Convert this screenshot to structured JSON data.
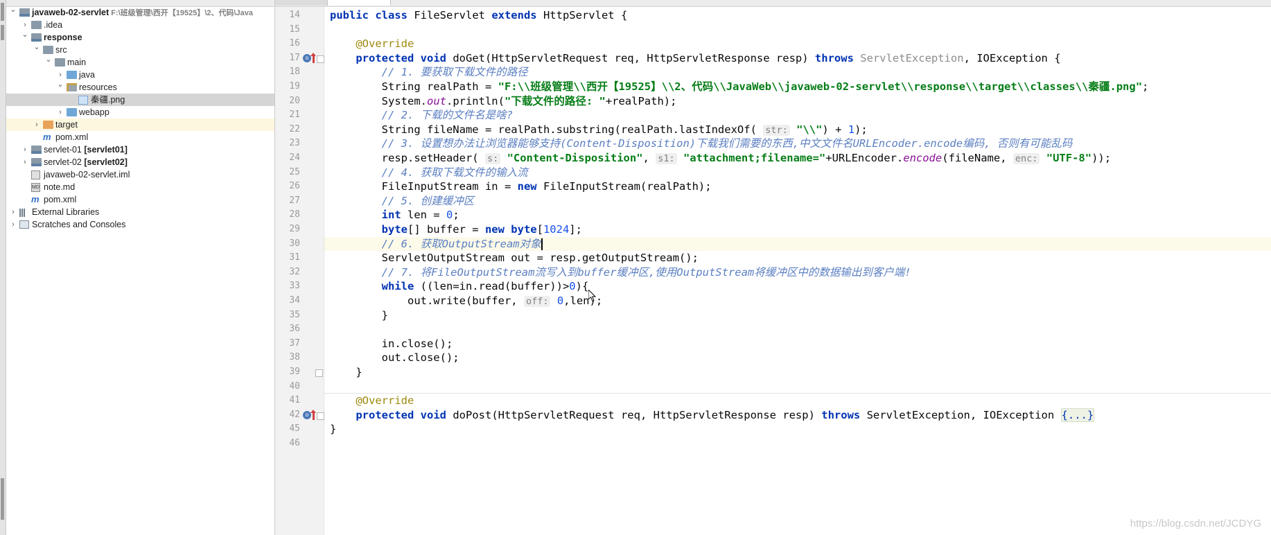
{
  "project_tree": [
    {
      "label": "javaweb-02-servlet",
      "suffix": "F:\\班级管理\\西开【19525】\\2、代码\\Java",
      "bold": true,
      "level": 0,
      "arrow": "down",
      "icon": "module-folder-icon"
    },
    {
      "label": ".idea",
      "level": 1,
      "arrow": "right",
      "icon": "folder-icon"
    },
    {
      "label": "response",
      "bold": true,
      "level": 1,
      "arrow": "down",
      "icon": "module-folder-icon"
    },
    {
      "label": "src",
      "level": 2,
      "arrow": "down",
      "icon": "folder-icon"
    },
    {
      "label": "main",
      "level": 3,
      "arrow": "down",
      "icon": "folder-icon"
    },
    {
      "label": "java",
      "level": 4,
      "arrow": "right",
      "icon": "source-folder-icon"
    },
    {
      "label": "resources",
      "level": 4,
      "arrow": "down",
      "icon": "resources-folder-icon"
    },
    {
      "label": "秦疆.png",
      "level": 5,
      "arrow": "",
      "icon": "image-file-icon",
      "selected": true
    },
    {
      "label": "webapp",
      "level": 4,
      "arrow": "right",
      "icon": "web-folder-icon"
    },
    {
      "label": "target",
      "level": 2,
      "arrow": "right",
      "icon": "excluded-folder-icon",
      "highlighted": true
    },
    {
      "label": "pom.xml",
      "level": 2,
      "arrow": "",
      "icon": "maven-icon"
    },
    {
      "label": "servlet-01",
      "suffix": "[servlet01]",
      "level": 1,
      "arrow": "right",
      "icon": "module-folder-icon"
    },
    {
      "label": "servlet-02",
      "suffix": "[servlet02]",
      "level": 1,
      "arrow": "right",
      "icon": "module-folder-icon"
    },
    {
      "label": "javaweb-02-servlet.iml",
      "level": 1,
      "arrow": "",
      "icon": "iml-file-icon"
    },
    {
      "label": "note.md",
      "level": 1,
      "arrow": "",
      "icon": "markdown-file-icon"
    },
    {
      "label": "pom.xml",
      "level": 1,
      "arrow": "",
      "icon": "maven-icon"
    },
    {
      "label": "External Libraries",
      "level": 0,
      "arrow": "right",
      "icon": "libraries-icon"
    },
    {
      "label": "Scratches and Consoles",
      "level": 0,
      "arrow": "right",
      "icon": "scratches-icon"
    }
  ],
  "editor": {
    "line_numbers": [
      "14",
      "15",
      "16",
      "17",
      "18",
      "19",
      "20",
      "21",
      "22",
      "23",
      "24",
      "25",
      "26",
      "27",
      "28",
      "29",
      "30",
      "31",
      "32",
      "33",
      "34",
      "35",
      "36",
      "37",
      "38",
      "39",
      "40",
      "41",
      "42",
      "45",
      "46"
    ],
    "current_line": "30",
    "lines": [
      [
        [
          "kw",
          "public "
        ],
        [
          "kw",
          "class "
        ],
        [
          "",
          "FileServlet "
        ],
        [
          "kw",
          "extends "
        ],
        [
          "",
          "HttpServlet {"
        ]
      ],
      [],
      [
        [
          "",
          "    "
        ],
        [
          "ann",
          "@Override"
        ]
      ],
      [
        [
          "",
          "    "
        ],
        [
          "kw",
          "protected "
        ],
        [
          "kw",
          "void "
        ],
        [
          "",
          "doGet(HttpServletRequest req, HttpServletResponse resp) "
        ],
        [
          "kw",
          "throws "
        ],
        [
          "muted",
          "ServletException"
        ],
        [
          "",
          ", IOException {"
        ]
      ],
      [
        [
          "",
          "        "
        ],
        [
          "cmt",
          "// 1. 要获取下载文件的路径"
        ]
      ],
      [
        [
          "",
          "        String realPath = "
        ],
        [
          "str",
          "\"F:\\\\班级管理\\\\西开【19525】\\\\2、代码\\\\JavaWeb\\\\javaweb-02-servlet\\\\response\\\\target\\\\classes\\\\秦疆.png\""
        ],
        [
          "",
          ";"
        ]
      ],
      [
        [
          "",
          "        System."
        ],
        [
          "fld",
          "out"
        ],
        [
          "",
          ".println("
        ],
        [
          "str",
          "\"下载文件的路径: \""
        ],
        [
          "",
          "+realPath);"
        ]
      ],
      [
        [
          "",
          "        "
        ],
        [
          "cmt",
          "// 2. 下载的文件名是啥?"
        ]
      ],
      [
        [
          "",
          "        String fileName = realPath.substring(realPath.lastIndexOf( "
        ],
        [
          "hint",
          "str:"
        ],
        [
          "str",
          " \"\\\\\""
        ],
        [
          "",
          ") + "
        ],
        [
          "num",
          "1"
        ],
        [
          "",
          ");"
        ]
      ],
      [
        [
          "",
          "        "
        ],
        [
          "cmt",
          "// 3. 设置想办法让浏览器能够支持(Content-Disposition)下载我们需要的东西,中文文件名URLEncoder.encode编码, 否则有可能乱码"
        ]
      ],
      [
        [
          "",
          "        resp.setHeader( "
        ],
        [
          "hint",
          "s:"
        ],
        [
          "str",
          " \"Content-Disposition\""
        ],
        [
          "",
          ", "
        ],
        [
          "hint",
          "s1:"
        ],
        [
          "str",
          " \"attachment;filename=\""
        ],
        [
          "",
          "+URLEncoder."
        ],
        [
          "fld",
          "encode"
        ],
        [
          "",
          "(fileName, "
        ],
        [
          "hint",
          "enc:"
        ],
        [
          "str",
          " \"UTF-8\""
        ],
        [
          "",
          "));"
        ]
      ],
      [
        [
          "",
          "        "
        ],
        [
          "cmt",
          "// 4. 获取下载文件的输入流"
        ]
      ],
      [
        [
          "",
          "        FileInputStream in = "
        ],
        [
          "kw",
          "new "
        ],
        [
          "",
          "FileInputStream(realPath);"
        ]
      ],
      [
        [
          "",
          "        "
        ],
        [
          "cmt",
          "// 5. 创建缓冲区"
        ]
      ],
      [
        [
          "",
          "        "
        ],
        [
          "kw",
          "int "
        ],
        [
          "",
          "len = "
        ],
        [
          "num",
          "0"
        ],
        [
          "",
          ";"
        ]
      ],
      [
        [
          "",
          "        "
        ],
        [
          "kw",
          "byte"
        ],
        [
          "",
          "[] buffer = "
        ],
        [
          "kw",
          "new "
        ],
        [
          "kw",
          "byte"
        ],
        [
          "",
          "["
        ],
        [
          "num",
          "1024"
        ],
        [
          "",
          "];"
        ]
      ],
      [
        [
          "",
          "        "
        ],
        [
          "cmt",
          "// 6. 获取OutputStream对象"
        ],
        [
          "caret",
          ""
        ]
      ],
      [
        [
          "",
          "        ServletOutputStream out = resp.getOutputStream();"
        ]
      ],
      [
        [
          "",
          "        "
        ],
        [
          "cmt",
          "// 7. 将FileOutputStream流写入到buffer缓冲区,使用OutputStream将缓冲区中的数据输出到客户端!"
        ]
      ],
      [
        [
          "",
          "        "
        ],
        [
          "kw",
          "while "
        ],
        [
          "",
          "((len=in.read(buffer))>"
        ],
        [
          "num",
          "0"
        ],
        [
          "",
          "){"
        ]
      ],
      [
        [
          "",
          "            out.write(buffer, "
        ],
        [
          "hint",
          "off:"
        ],
        [
          "num",
          " 0"
        ],
        [
          "",
          ",len);"
        ]
      ],
      [
        [
          "",
          "        }"
        ]
      ],
      [],
      [
        [
          "",
          "        in.close();"
        ]
      ],
      [
        [
          "",
          "        out.close();"
        ]
      ],
      [
        [
          "",
          "    }"
        ]
      ],
      [],
      [
        [
          "",
          "    "
        ],
        [
          "ann",
          "@Override"
        ]
      ],
      [
        [
          "",
          "    "
        ],
        [
          "kw",
          "protected "
        ],
        [
          "kw",
          "void "
        ],
        [
          "",
          "doPost(HttpServletRequest req, HttpServletResponse resp) "
        ],
        [
          "kw",
          "throws "
        ],
        [
          "",
          "ServletException, IOException "
        ],
        [
          "foldtext",
          "{...}"
        ]
      ],
      [
        [
          "",
          "}"
        ]
      ],
      []
    ]
  },
  "watermark": "https://blog.csdn.net/JCDYG"
}
